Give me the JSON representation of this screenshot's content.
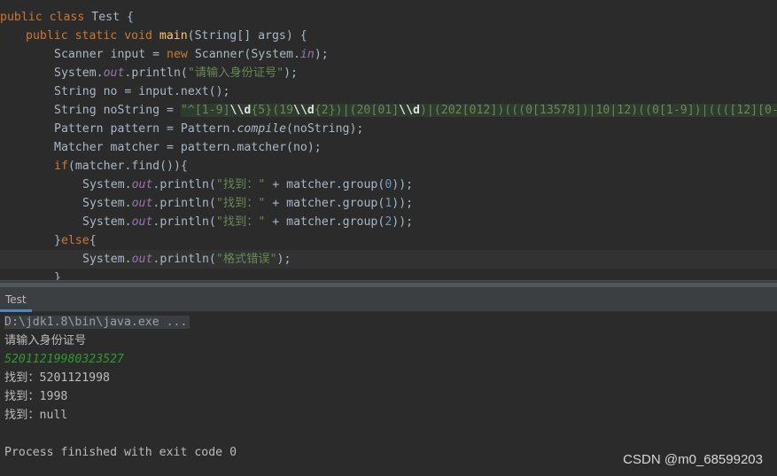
{
  "editor": {
    "lines": {
      "l1": {
        "kw1": "public",
        "kw2": "class",
        "name": "Test",
        "rest": " {"
      },
      "l2": {
        "kw1": "public",
        "kw2": "static",
        "kw3": "void",
        "fn": "main",
        "rest": "(String[] args) {"
      },
      "l3": {
        "a": "Scanner input = ",
        "kw": "new",
        "b": " Scanner(System.",
        "st": "in",
        "c": ");"
      },
      "l4": {
        "a": "System.",
        "st": "out",
        "b": ".println(",
        "str": "\"请输入身份证号\"",
        "c": ");"
      },
      "l5": {
        "a": "String no = input.next();"
      },
      "l6": {
        "a": "String noString = ",
        "q": "\"",
        "r1": "^",
        "r2": "[1-9]",
        "r3": "\\\\d",
        "r4": "{5}",
        "r5": "(19",
        "r6": "\\\\d",
        "r7": "{2})|(20",
        "r8": "[01]",
        "r9": "\\\\d",
        "r10": ")|(202",
        "r11": "[012]",
        "r12": ")(((0",
        "r13": "[13578]",
        "r14": ")|10|12)((0",
        "r15": "[1-9]",
        "r16": ")|(((",
        "r17": "[12]",
        "r18": "[0-"
      },
      "l7": {
        "a": "Pattern pattern = Pattern.",
        "it": "compile",
        "b": "(noString);"
      },
      "l8": {
        "a": "Matcher matcher = pattern.matcher(no);"
      },
      "l9": {
        "kw": "if",
        "a": "(matcher.find()){"
      },
      "l10": {
        "a": "System.",
        "st": "out",
        "b": ".println(",
        "str": "\"找到：\"",
        "c": " + matcher.group(",
        "n": "0",
        "d": "));"
      },
      "l11": {
        "a": "System.",
        "st": "out",
        "b": ".println(",
        "str": "\"找到：\"",
        "c": " + matcher.group(",
        "n": "1",
        "d": "));"
      },
      "l12": {
        "a": "System.",
        "st": "out",
        "b": ".println(",
        "str": "\"找到：\"",
        "c": " + matcher.group(",
        "n": "2",
        "d": "));"
      },
      "l13": {
        "a": "}",
        "kw": "else",
        "b": "{"
      },
      "l14": {
        "a": "System.",
        "st": "out",
        "b": ".println(",
        "str": "\"格式错误\"",
        "c": ");"
      },
      "l15": {
        "a": "}"
      }
    }
  },
  "run_panel": {
    "tab_label": "Test",
    "command": "D:\\jdk1.8\\bin\\java.exe ...",
    "prompt": "请输入身份证号",
    "user_input": "52011219980323527",
    "out1": "找到：5201121998",
    "out2": "找到：1998",
    "out3": "找到：null",
    "exit": "Process finished with exit code 0"
  },
  "watermark": "CSDN @m0_68599203",
  "colors": {
    "background": "#2b2b2b",
    "keyword": "#cc7832",
    "string": "#6a8759",
    "function": "#ffc66d",
    "static_field": "#9876aa",
    "number": "#6897bb",
    "console_input": "#2e9a2e",
    "tab_underline": "#4a88c7"
  }
}
